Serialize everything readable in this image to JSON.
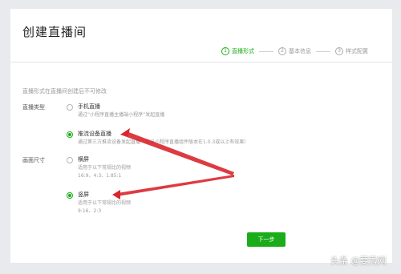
{
  "page": {
    "title": "创建直播间"
  },
  "steps": [
    {
      "num": "1",
      "label": "直播形式"
    },
    {
      "num": "2",
      "label": "基本信息"
    },
    {
      "num": "3",
      "label": "样式配置"
    }
  ],
  "hint": "直播形式在直播间创建后不可修改",
  "live_type": {
    "label": "直播类型",
    "options": [
      {
        "title": "手机直播",
        "desc": "通过“小程序直播主播端小程序”发起直播"
      },
      {
        "title": "推流设备直播",
        "desc": "通过第三方推流设备发起直播（仅当小程序直播组件版本在1.0.3或以上有效果）"
      }
    ]
  },
  "screen_size": {
    "label": "画面尺寸",
    "options": [
      {
        "title": "横屏",
        "desc1": "适用于以下常规比的视频",
        "desc2": "16:9、4:3、1.85:1"
      },
      {
        "title": "竖屏",
        "desc1": "适用于以下常规比的视频",
        "desc2": "9:16、2:3"
      }
    ]
  },
  "next_button": "下一步",
  "watermark": "头条 @要秀网",
  "colors": {
    "accent": "#1aad19",
    "annotation": "#d9262c"
  }
}
